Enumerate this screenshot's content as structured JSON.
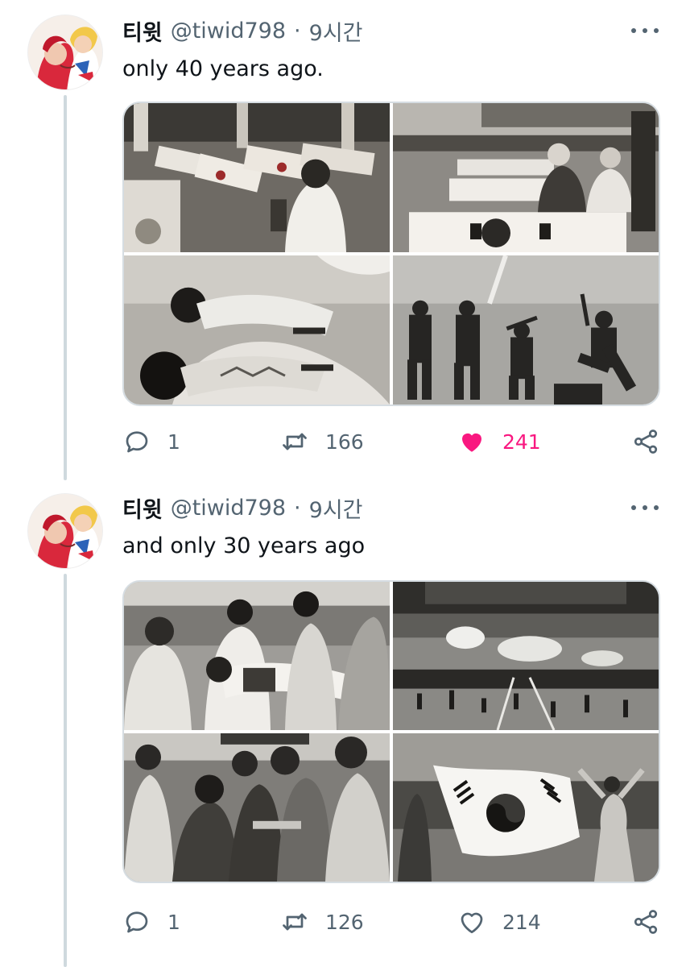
{
  "tweets": [
    {
      "name": "티윗",
      "handle": "@tiwid798",
      "separator": "·",
      "time": "9시간",
      "text": "only 40 years ago.",
      "stats": {
        "replies": "1",
        "retweets": "166",
        "likes": "241"
      },
      "liked": true,
      "like_color": "#f91880"
    },
    {
      "name": "티윗",
      "handle": "@tiwid798",
      "separator": "·",
      "time": "9시간",
      "text": "and only 30 years ago",
      "stats": {
        "replies": "1",
        "retweets": "126",
        "likes": "214"
      },
      "liked": false,
      "like_color": "#536471"
    }
  ],
  "icons": {
    "reply": "reply-bubble-icon",
    "retweet": "retweet-arrows-icon",
    "like": "heart-icon",
    "share": "share-nodes-icon",
    "more": "more-dots-icon"
  },
  "colors": {
    "text": "#0f1419",
    "secondary": "#536471",
    "like": "#f91880",
    "thread_line": "#cfd9de"
  }
}
